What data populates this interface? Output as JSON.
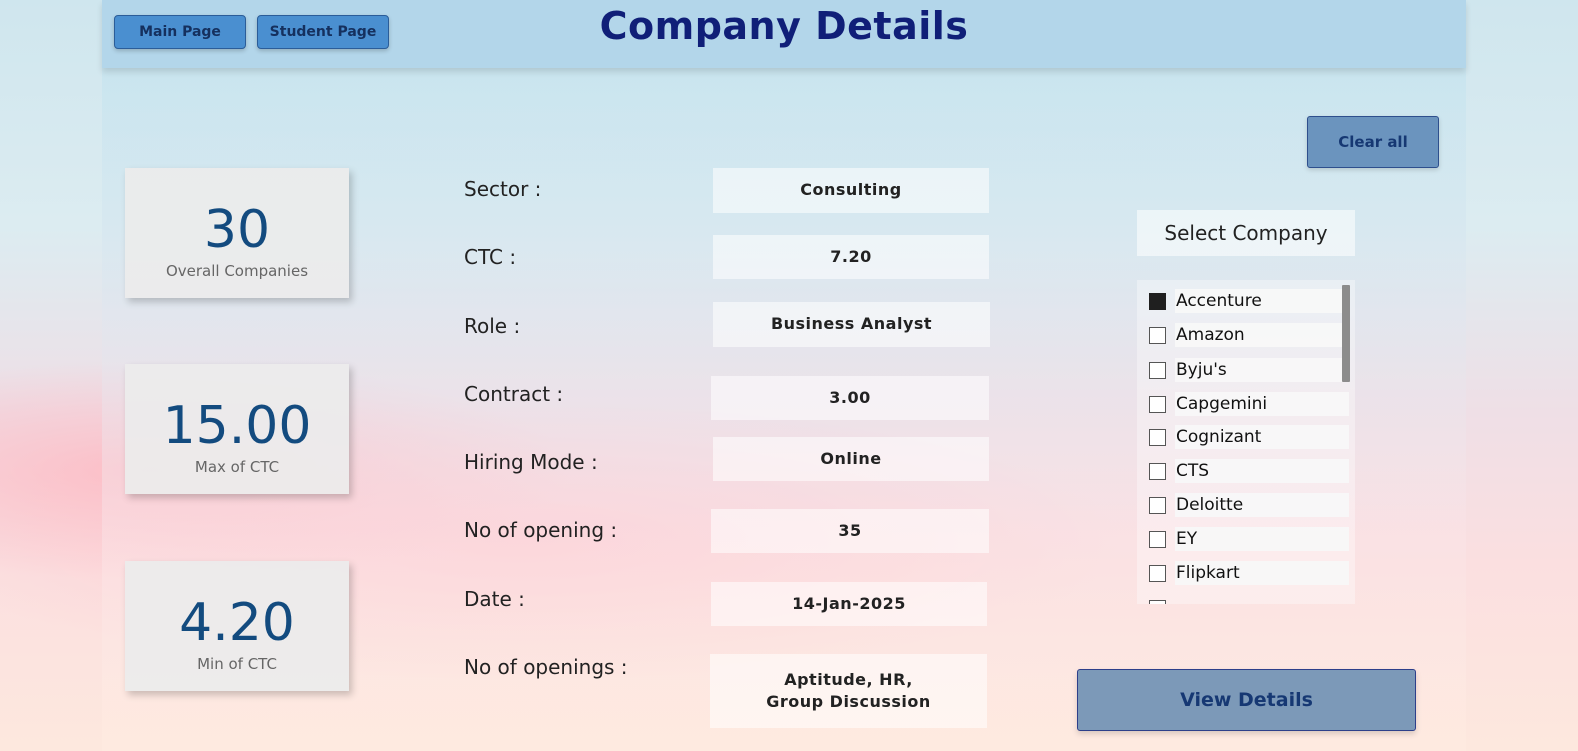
{
  "header": {
    "title": "Company Details",
    "nav": {
      "main_page": "Main Page",
      "student_page": "Student Page"
    }
  },
  "kpis": {
    "overall": {
      "value": "30",
      "label": "Overall Companies"
    },
    "max_ctc": {
      "value": "15.00",
      "label": "Max of CTC"
    },
    "min_ctc": {
      "value": "4.20",
      "label": "Min of CTC"
    }
  },
  "details": {
    "sector": {
      "label": "Sector :",
      "value": "Consulting"
    },
    "ctc": {
      "label": "CTC :",
      "value": "7.20"
    },
    "role": {
      "label": "Role :",
      "value": "Business Analyst"
    },
    "contract": {
      "label": "Contract :",
      "value": "3.00"
    },
    "hiring_mode": {
      "label": "Hiring Mode :",
      "value": "Online"
    },
    "no_of_opening": {
      "label": "No of opening :",
      "value": "35"
    },
    "date": {
      "label": "Date :",
      "value": "14-Jan-2025"
    },
    "no_of_openings": {
      "label": "No of openings :",
      "value": "Aptitude, HR, Group Discussion"
    }
  },
  "slicer": {
    "title": "Select Company",
    "clear_label": "Clear all",
    "items": [
      {
        "label": "Accenture",
        "checked": true
      },
      {
        "label": "Amazon",
        "checked": false
      },
      {
        "label": "Byju's",
        "checked": false
      },
      {
        "label": "Capgemini",
        "checked": false
      },
      {
        "label": "Cognizant",
        "checked": false
      },
      {
        "label": "CTS",
        "checked": false
      },
      {
        "label": "Deloitte",
        "checked": false
      },
      {
        "label": "EY",
        "checked": false
      },
      {
        "label": "Flipkart",
        "checked": false
      }
    ]
  },
  "actions": {
    "view_details": "View Details"
  }
}
